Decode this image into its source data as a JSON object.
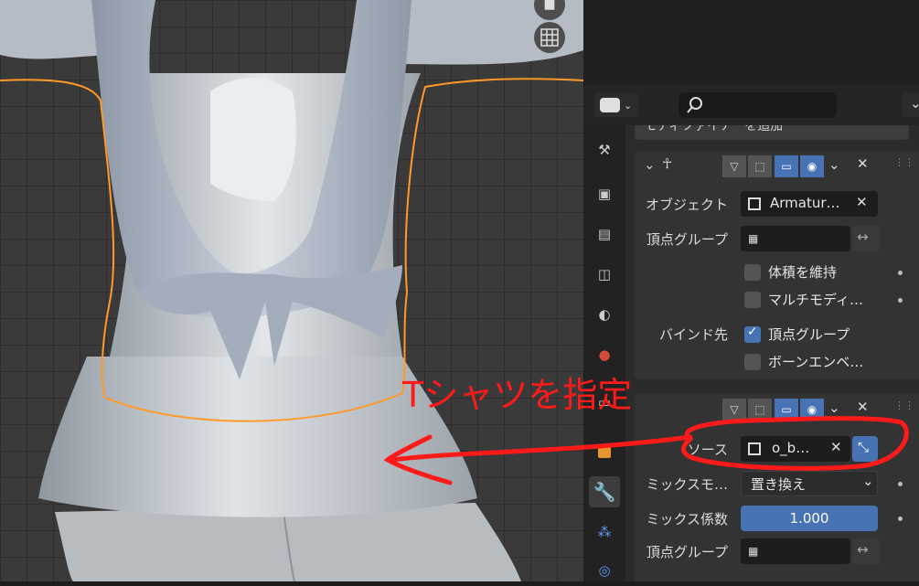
{
  "annotation": {
    "text": "Tシャツを指定",
    "color": "#ff1a1a"
  },
  "colors": {
    "accent": "#4772b3",
    "selection_outline": "#ff9a28",
    "panel": "#2b2b2b"
  },
  "properties": {
    "add_modifier_label": "モディファイアーを追加",
    "armature_modifier": {
      "object_label": "オブジェクト",
      "object_value": "Armatur…",
      "vertex_group_label": "頂点グループ",
      "preserve_volume_label": "体積を維持",
      "multi_modifier_label": "マルチモディ…",
      "bind_to_label": "バインド先",
      "bind_vertex_group_label": "頂点グループ",
      "bind_vertex_group_checked": true,
      "bone_envelopes_label": "ボーンエンベ…"
    },
    "data_transfer_modifier": {
      "source_label": "ソース",
      "source_value": "o_b…",
      "mix_mode_label": "ミックスモ…",
      "mix_mode_value": "置き換え",
      "mix_factor_label": "ミックス係数",
      "mix_factor_value": "1.000",
      "vertex_group_label": "頂点グループ"
    }
  },
  "tabs": [
    "tool-icon",
    "render-icon",
    "output-icon",
    "view-layer-icon",
    "scene-icon",
    "world-icon",
    "collection-icon",
    "object-icon",
    "modifier-icon",
    "particles-icon",
    "physics-icon"
  ]
}
